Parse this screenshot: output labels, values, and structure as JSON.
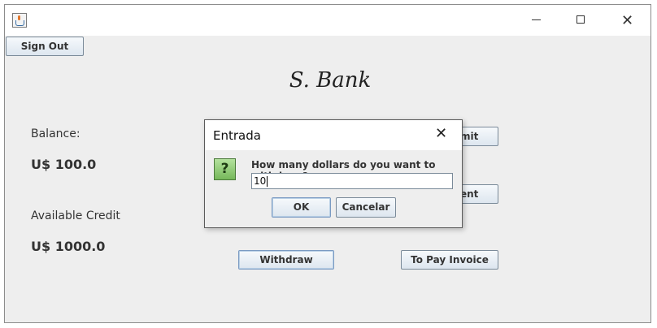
{
  "window": {
    "sign_out_label": "Sign Out",
    "bank_title": "S. Bank",
    "balance_label": "Balance:",
    "balance_value": "U$ 100.0",
    "credit_label": "Available Credit",
    "credit_value": "U$ 1000.0",
    "deposit_partial": "mit",
    "payment_partial": "ent",
    "withdraw_label": "Withdraw",
    "pay_invoice_label": "To Pay Invoice",
    "controls": {
      "minimize": "—",
      "maximize": "☐",
      "close": "✕"
    }
  },
  "dialog": {
    "title": "Entrada",
    "close": "✕",
    "icon": "question-icon",
    "icon_glyph": "?",
    "message": "How many dollars do you want to withdraw?",
    "input_value": "10",
    "ok_label": "OK",
    "cancel_label": "Cancelar"
  }
}
